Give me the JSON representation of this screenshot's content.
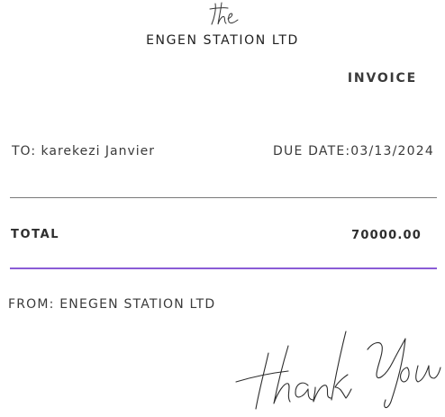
{
  "header": {
    "logo_text": "the",
    "company_name": "ENGEN STATION LTD"
  },
  "invoice": {
    "title": "INVOICE",
    "to_label": "TO:",
    "to_name": "karekezi Janvier",
    "due_label": "DUE DATE:",
    "due_date": "03/13/2024",
    "total_label": "TOTAL",
    "total_value": "70000.00",
    "from_label": "FROM:",
    "from_name": "ENEGEN STATION LTD"
  },
  "footer": {
    "closing_text": "thank You"
  },
  "colors": {
    "accent": "#8a5cd6",
    "divider": "#7a7a7a",
    "text": "#3a3a3a"
  }
}
